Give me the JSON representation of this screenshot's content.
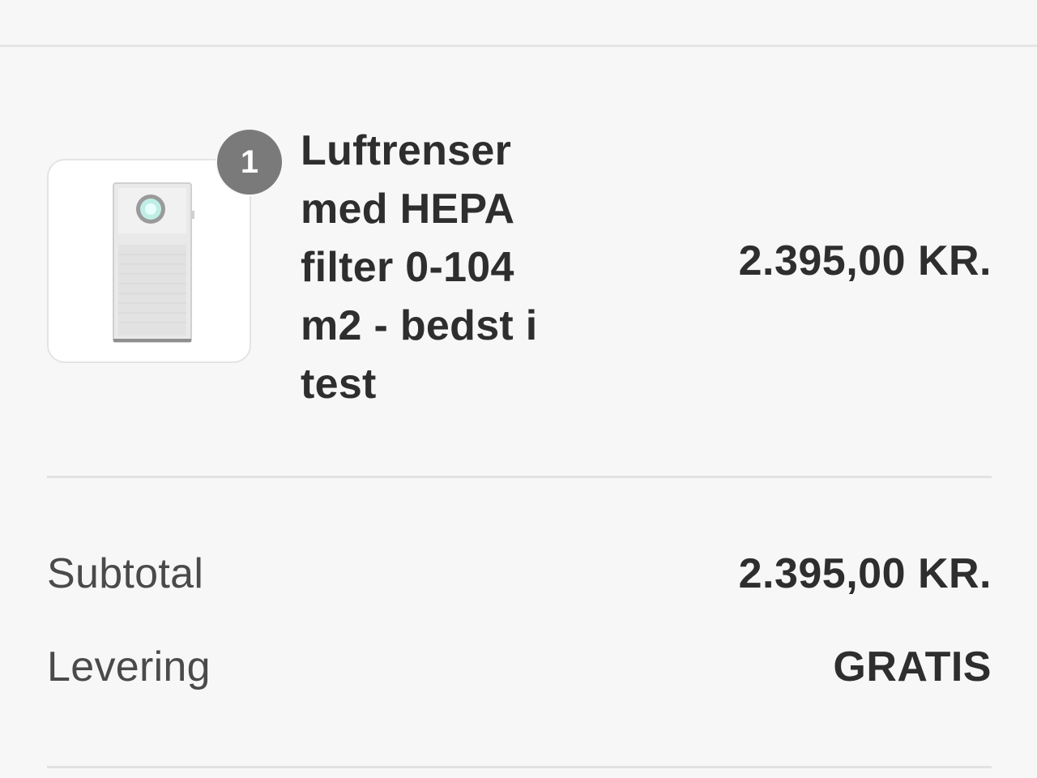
{
  "cart": {
    "items": [
      {
        "quantity": "1",
        "title": "Luftrenser med HEPA filter 0-104 m2 - bedst i test",
        "price": "2.395,00 KR.",
        "image_icon": "air-purifier-icon"
      }
    ]
  },
  "summary": {
    "subtotal_label": "Subtotal",
    "subtotal_value": "2.395,00 KR.",
    "shipping_label": "Levering",
    "shipping_value": "GRATIS"
  },
  "colors": {
    "background": "#f7f7f7",
    "badge": "#7a7a7a",
    "text": "#2e2e2e",
    "divider": "#e2e2e2"
  }
}
